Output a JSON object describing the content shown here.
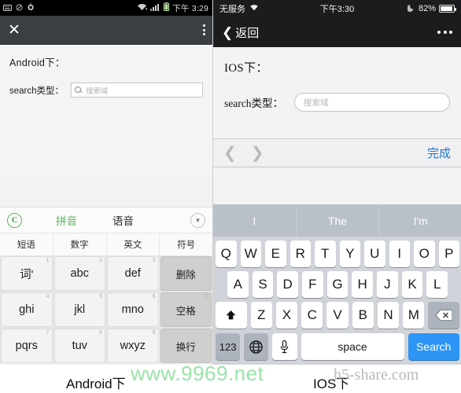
{
  "android": {
    "statusbar": {
      "icons": [
        "keyboard-icon",
        "mute-icon",
        "alarm-icon",
        "wifi-icon",
        "signal-icon",
        "battery-icon"
      ],
      "time": "下午 3:29"
    },
    "toolbar": {
      "close_label": "✕",
      "overflow_name": "overflow-menu"
    },
    "content": {
      "heading": "Android下：",
      "field_label": "search类型：",
      "field_value": "",
      "field_placeholder": "搜索域"
    },
    "keyboard": {
      "logo": "C",
      "tab_pinyin": "拼音",
      "tab_voice": "语音",
      "collapse_icon": "chevron-down-icon",
      "fn_row": [
        "短语",
        "数字",
        "英文",
        "符号"
      ],
      "rows": [
        [
          {
            "label": "词'",
            "num": "1",
            "type": "key"
          },
          {
            "label": "abc",
            "num": "2",
            "type": "key"
          },
          {
            "label": "def",
            "num": "3",
            "type": "key"
          },
          {
            "label": "删除",
            "num": "",
            "type": "fn"
          }
        ],
        [
          {
            "label": "ghi",
            "num": "4",
            "type": "key"
          },
          {
            "label": "jkl",
            "num": "5",
            "type": "key"
          },
          {
            "label": "mno",
            "num": "6",
            "type": "key"
          },
          {
            "label": "空格",
            "num": "0",
            "type": "fn"
          }
        ],
        [
          {
            "label": "pqrs",
            "num": "7",
            "type": "key"
          },
          {
            "label": "tuv",
            "num": "8",
            "type": "key"
          },
          {
            "label": "wxyz",
            "num": "9",
            "type": "key"
          },
          {
            "label": "换行",
            "num": "",
            "type": "fn"
          }
        ]
      ]
    },
    "caption": "Android下"
  },
  "ios": {
    "statusbar": {
      "carrier": "无服务",
      "wifi_icon": "wifi-icon",
      "time": "下午3:30",
      "moon_icon": "moon-icon",
      "battery_percent": "82%"
    },
    "navbar": {
      "back_label": "返回",
      "back_icon": "chevron-left-icon",
      "more_icon": "more-dots-icon"
    },
    "content": {
      "heading": "IOS下：",
      "field_label": "search类型：",
      "field_value": "",
      "field_placeholder": "搜索域"
    },
    "accessory": {
      "prev_icon": "chevron-left-icon",
      "next_icon": "chevron-right-icon",
      "done_label": "完成",
      "done_color": "#1f76c9"
    },
    "keyboard": {
      "suggestions": [
        "I",
        "The",
        "I'm"
      ],
      "row1": [
        "Q",
        "W",
        "E",
        "R",
        "T",
        "Y",
        "U",
        "I",
        "O",
        "P"
      ],
      "row2": [
        "A",
        "S",
        "D",
        "F",
        "G",
        "H",
        "J",
        "K",
        "L"
      ],
      "row3": [
        "Z",
        "X",
        "C",
        "V",
        "B",
        "N",
        "M"
      ],
      "shift_icon": "shift-icon",
      "delete_icon": "backspace-icon",
      "numeric_label": "123",
      "globe_icon": "globe-icon",
      "mic_icon": "microphone-icon",
      "space_label": "space",
      "search_label": "Search",
      "search_color": "#2d95f5"
    },
    "caption": "IOS下"
  },
  "watermarks": {
    "green": "www.9969.net",
    "gray": "h5-share.com"
  }
}
